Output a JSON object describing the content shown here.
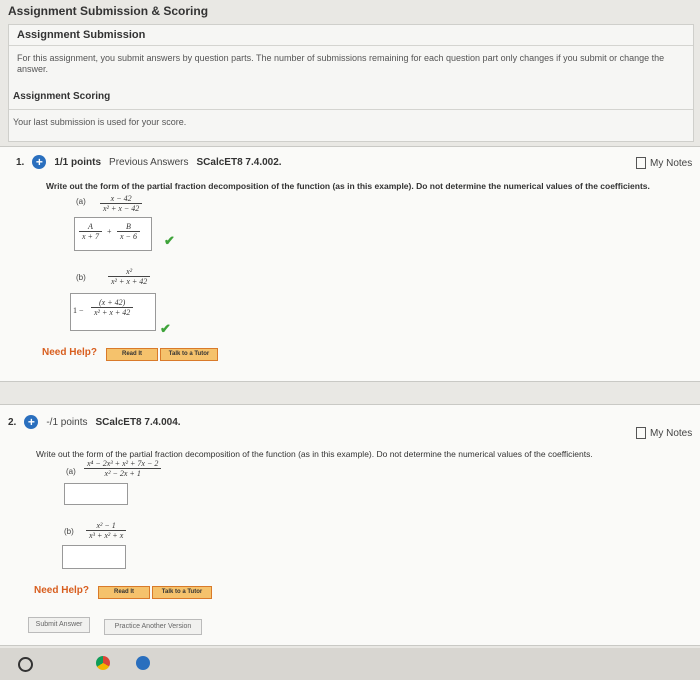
{
  "header": {
    "title": "Assignment Submission & Scoring"
  },
  "submission": {
    "title": "Assignment Submission",
    "text": "For this assignment, you submit answers by question parts. The number of submissions remaining for each question part only changes if you submit or change the answer.",
    "scoring_title": "Assignment Scoring",
    "scoring_text": "Your last submission is used for your score."
  },
  "q1": {
    "number": "1.",
    "points": "1/1 points",
    "prev": "Previous Answers",
    "code": "SCalcET8 7.4.002.",
    "notes": "My Notes",
    "prompt": "Write out the form of the partial fraction decomposition of the function (as in this example). Do not determine the numerical values of the coefficients.",
    "a_label": "(a)",
    "a_num": "x − 42",
    "a_den": "x² + x − 42",
    "ans_a_A": "A",
    "ans_a_Aden": "x + 7",
    "ans_a_plus": "+",
    "ans_a_B": "B",
    "ans_a_Bden": "x − 6",
    "b_label": "(b)",
    "b_num": "x²",
    "b_den": "x² + x + 42",
    "ans_b_one": "1 −",
    "ans_b_num": "(x + 42)",
    "ans_b_den": "x² + x + 42",
    "need_help": "Need Help?",
    "read": "Read It",
    "talk": "Talk to a Tutor"
  },
  "q2": {
    "number": "2.",
    "points": "-/1 points",
    "code": "SCalcET8 7.4.004.",
    "notes": "My Notes",
    "prompt": "Write out the form of the partial fraction decomposition of the function (as in this example). Do not determine the numerical values of the coefficients.",
    "a_label": "(a)",
    "a_num": "x⁴ − 2x³ + x² + 7x − 2",
    "a_den": "x² − 2x + 1",
    "b_label": "(b)",
    "b_num": "x² − 1",
    "b_den": "x³ + x² + x",
    "need_help": "Need Help?",
    "read": "Read It",
    "talk": "Talk to a Tutor",
    "submit": "Submit Answer",
    "practice": "Practice Another Version"
  },
  "colors": {
    "accent": "#2a6fbe",
    "check": "#3ea33a",
    "help": "#d85e1f"
  },
  "icons": [
    "plus-circle-icon",
    "note-icon",
    "check-icon",
    "search-icon",
    "chrome-icon",
    "edge-icon"
  ]
}
